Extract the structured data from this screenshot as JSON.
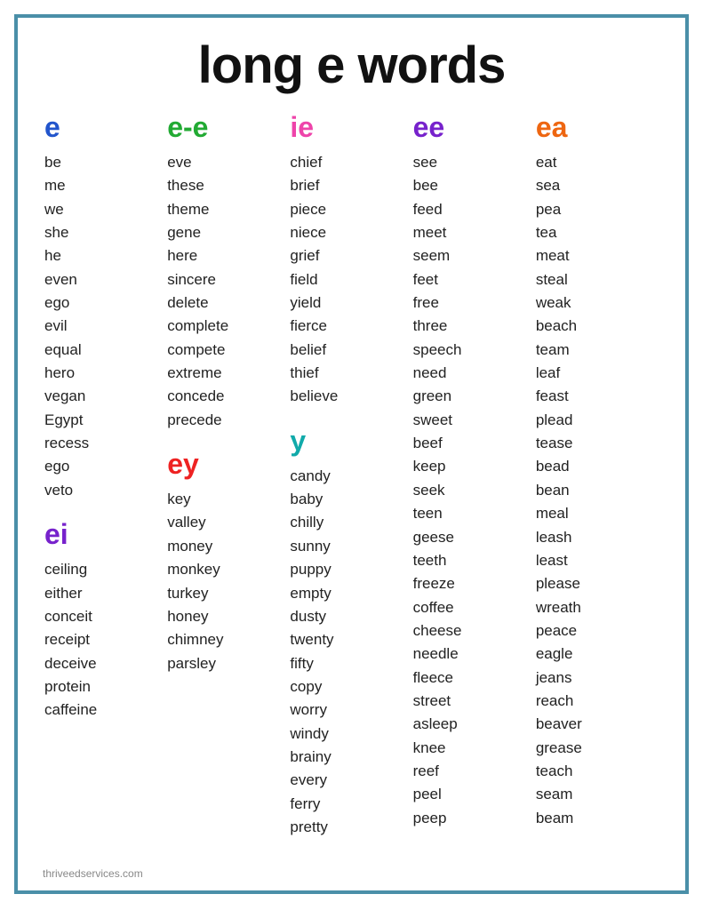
{
  "title": "long e words",
  "footer": "thriveedservices.com",
  "columns": [
    {
      "id": "col-e",
      "sections": [
        {
          "header": "e",
          "headerClass": "blue",
          "words": [
            "be",
            "me",
            "we",
            "she",
            "he",
            "even",
            "ego",
            "evil",
            "equal",
            "hero",
            "vegan",
            "Egypt",
            "recess",
            "ego",
            "veto"
          ]
        },
        {
          "header": "ei",
          "headerClass": "purple",
          "gap": true,
          "words": [
            "ceiling",
            "either",
            "conceit",
            "receipt",
            "deceive",
            "protein",
            "caffeine"
          ]
        }
      ]
    },
    {
      "id": "col-ee",
      "sections": [
        {
          "header": "e-e",
          "headerClass": "green",
          "words": [
            "eve",
            "these",
            "theme",
            "gene",
            "here",
            "sincere",
            "delete",
            "complete",
            "compete",
            "extreme",
            "concede",
            "precede"
          ]
        },
        {
          "header": "ey",
          "headerClass": "red",
          "gap": true,
          "words": [
            "key",
            "valley",
            "money",
            "monkey",
            "turkey",
            "honey",
            "chimney",
            "parsley"
          ]
        }
      ]
    },
    {
      "id": "col-ie",
      "sections": [
        {
          "header": "ie",
          "headerClass": "pink",
          "words": [
            "chief",
            "brief",
            "piece",
            "niece",
            "grief",
            "field",
            "yield",
            "fierce",
            "belief",
            "thief",
            "believe"
          ]
        },
        {
          "header": "y",
          "headerClass": "teal",
          "gap": true,
          "words": [
            "candy",
            "baby",
            "chilly",
            "sunny",
            "puppy",
            "empty",
            "dusty",
            "twenty",
            "fifty",
            "copy",
            "worry",
            "windy",
            "brainy",
            "every",
            "ferry",
            "pretty"
          ]
        }
      ]
    },
    {
      "id": "col-ee2",
      "sections": [
        {
          "header": "ee",
          "headerClass": "purple",
          "words": [
            "see",
            "bee",
            "feed",
            "meet",
            "seem",
            "feet",
            "free",
            "three",
            "speech",
            "need",
            "green",
            "sweet",
            "beef",
            "keep",
            "seek",
            "teen",
            "geese",
            "teeth",
            "freeze",
            "coffee",
            "cheese",
            "needle",
            "fleece",
            "street",
            "asleep",
            "knee",
            "reef",
            "peel",
            "peep"
          ]
        }
      ]
    },
    {
      "id": "col-ea",
      "sections": [
        {
          "header": "ea",
          "headerClass": "orange",
          "words": [
            "eat",
            "sea",
            "pea",
            "tea",
            "meat",
            "steal",
            "weak",
            "beach",
            "team",
            "leaf",
            "feast",
            "plead",
            "tease",
            "bead",
            "bean",
            "meal",
            "leash",
            "least",
            "please",
            "wreath",
            "peace",
            "eagle",
            "jeans",
            "reach",
            "beaver",
            "grease",
            "teach",
            "seam",
            "beam"
          ]
        }
      ]
    }
  ]
}
